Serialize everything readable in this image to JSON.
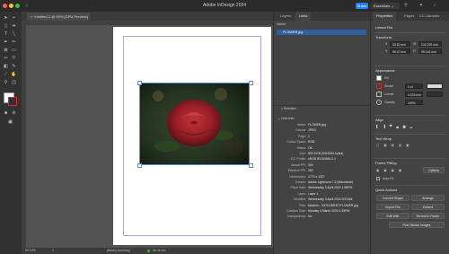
{
  "window": {
    "app_title": "Adobe InDesign 2024",
    "share_label": "Share",
    "workspace_label": "Essentials"
  },
  "document_tab": {
    "title": "*Untitled-1 @ 59% [GPU Preview]"
  },
  "status": {
    "zoom": "59.14%",
    "page": "1",
    "mode": "[Basic] (working)",
    "errors": "No errors"
  },
  "links_panel": {
    "tabs": [
      "Layers",
      "Links"
    ],
    "active_tab": "Links",
    "name_header": "Name",
    "items": [
      {
        "name": "FLOWER.jpg"
      }
    ],
    "selected_count": "1 Selected",
    "info_title": "Link Info",
    "info": [
      {
        "label": "Name:",
        "value": "FLOWER.jpg"
      },
      {
        "label": "Format:",
        "value": "JPEG"
      },
      {
        "label": "Page:",
        "value": "1"
      },
      {
        "label": "Colour Space:",
        "value": "RGB"
      },
      {
        "label": "Status:",
        "value": "OK"
      },
      {
        "label": "Size:",
        "value": "592.3 KB (3318343 bytes)"
      },
      {
        "label": "ICC Profile:",
        "value": "sRGB IEC61966-2.1"
      },
      {
        "label": "Actual PPI:",
        "value": "300"
      },
      {
        "label": "Effective PPI:",
        "value": "300"
      },
      {
        "label": "Dimensions:",
        "value": "1770 x 1327"
      },
      {
        "label": "Creator:",
        "value": "Adobe Lightroom 7.2 (Macintosh)"
      },
      {
        "label": "Place Date:",
        "value": "Wednesday 3 April 2024 1:58PM"
      },
      {
        "label": "Layer:",
        "value": "Layer 1"
      },
      {
        "label": "Modified:",
        "value": "Wednesday 3 April 2024 9:57AM"
      },
      {
        "label": "Path:",
        "value": "Macinto...:DOCUMENT:FLOWER.jpg"
      },
      {
        "label": "Creation Date:",
        "value": "Monday 4 March 2024 1:19PM"
      },
      {
        "label": "Transparency:",
        "value": "No"
      }
    ]
  },
  "properties": {
    "tabs": [
      "Properties",
      "Pages",
      "CC Libraries"
    ],
    "active_tab": "Properties",
    "linked_file_label": "Linked File",
    "transform_label": "Transform",
    "x": "33.52 mm",
    "y": "98.47 mm",
    "w": "132.229 mm",
    "h": "99.144 mm",
    "appearance_label": "Appearance",
    "fill_label": "Fill",
    "stroke_label": "Stroke",
    "stroke_weight": "0 pt",
    "corner_label": "Corner",
    "corner_value": "4.233 mm",
    "opacity_label": "Opacity",
    "opacity_value": "100%",
    "align_label": "Align",
    "text_wrap_label": "Text Wrap",
    "frame_fitting_label": "Frame Fitting",
    "options_label": "Options",
    "auto_fit_label": "Auto-Fit",
    "quick_actions_label": "Quick Actions",
    "quick_actions": [
      "Convert Shape",
      "Arrange",
      "Import File",
      "Embed",
      "Edit With",
      "Reveal in Finder",
      "Find Similar Images"
    ],
    "colors": {
      "accent": "#2680eb",
      "stroke_swatch": "#e8202a"
    }
  }
}
